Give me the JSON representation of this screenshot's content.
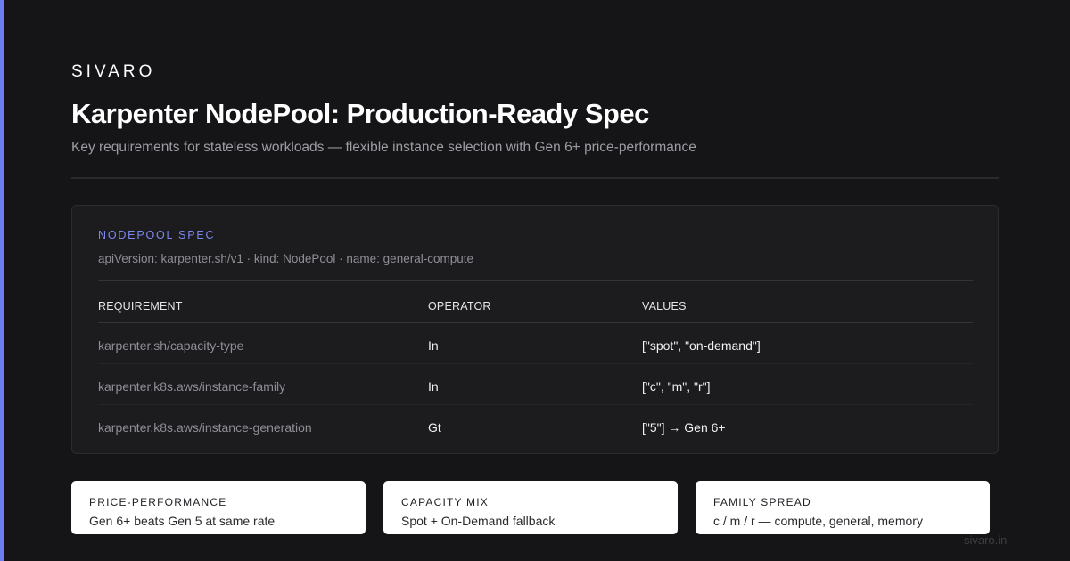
{
  "brand": "SIVARO",
  "title": "Karpenter NodePool: Production-Ready Spec",
  "subtitle": "Key requirements for stateless workloads — flexible instance selection with Gen 6+ price-performance",
  "spec": {
    "label": "NODEPOOL SPEC",
    "meta": "apiVersion: karpenter.sh/v1 · kind: NodePool · name: general-compute",
    "columns": [
      "REQUIREMENT",
      "OPERATOR",
      "VALUES"
    ],
    "rows": [
      {
        "requirement": "karpenter.sh/capacity-type",
        "operator": "In",
        "values": "[\"spot\", \"on-demand\"]"
      },
      {
        "requirement": "karpenter.k8s.aws/instance-family",
        "operator": "In",
        "values": "[\"c\", \"m\", \"r\"]"
      },
      {
        "requirement": "karpenter.k8s.aws/instance-generation",
        "operator": "Gt",
        "values": "[\"5\"] → Gen 6+"
      }
    ]
  },
  "cards": [
    {
      "label": "PRICE-PERFORMANCE",
      "value": "Gen 6+ beats Gen 5 at same rate"
    },
    {
      "label": "CAPACITY MIX",
      "value": "Spot + On-Demand fallback"
    },
    {
      "label": "FAMILY SPREAD",
      "value": "c / m / r — compute, general, memory"
    }
  ],
  "footer": "sivaro.in",
  "colors": {
    "accent": "#6f7df2",
    "background": "#151517",
    "card": "#1c1c1f"
  }
}
